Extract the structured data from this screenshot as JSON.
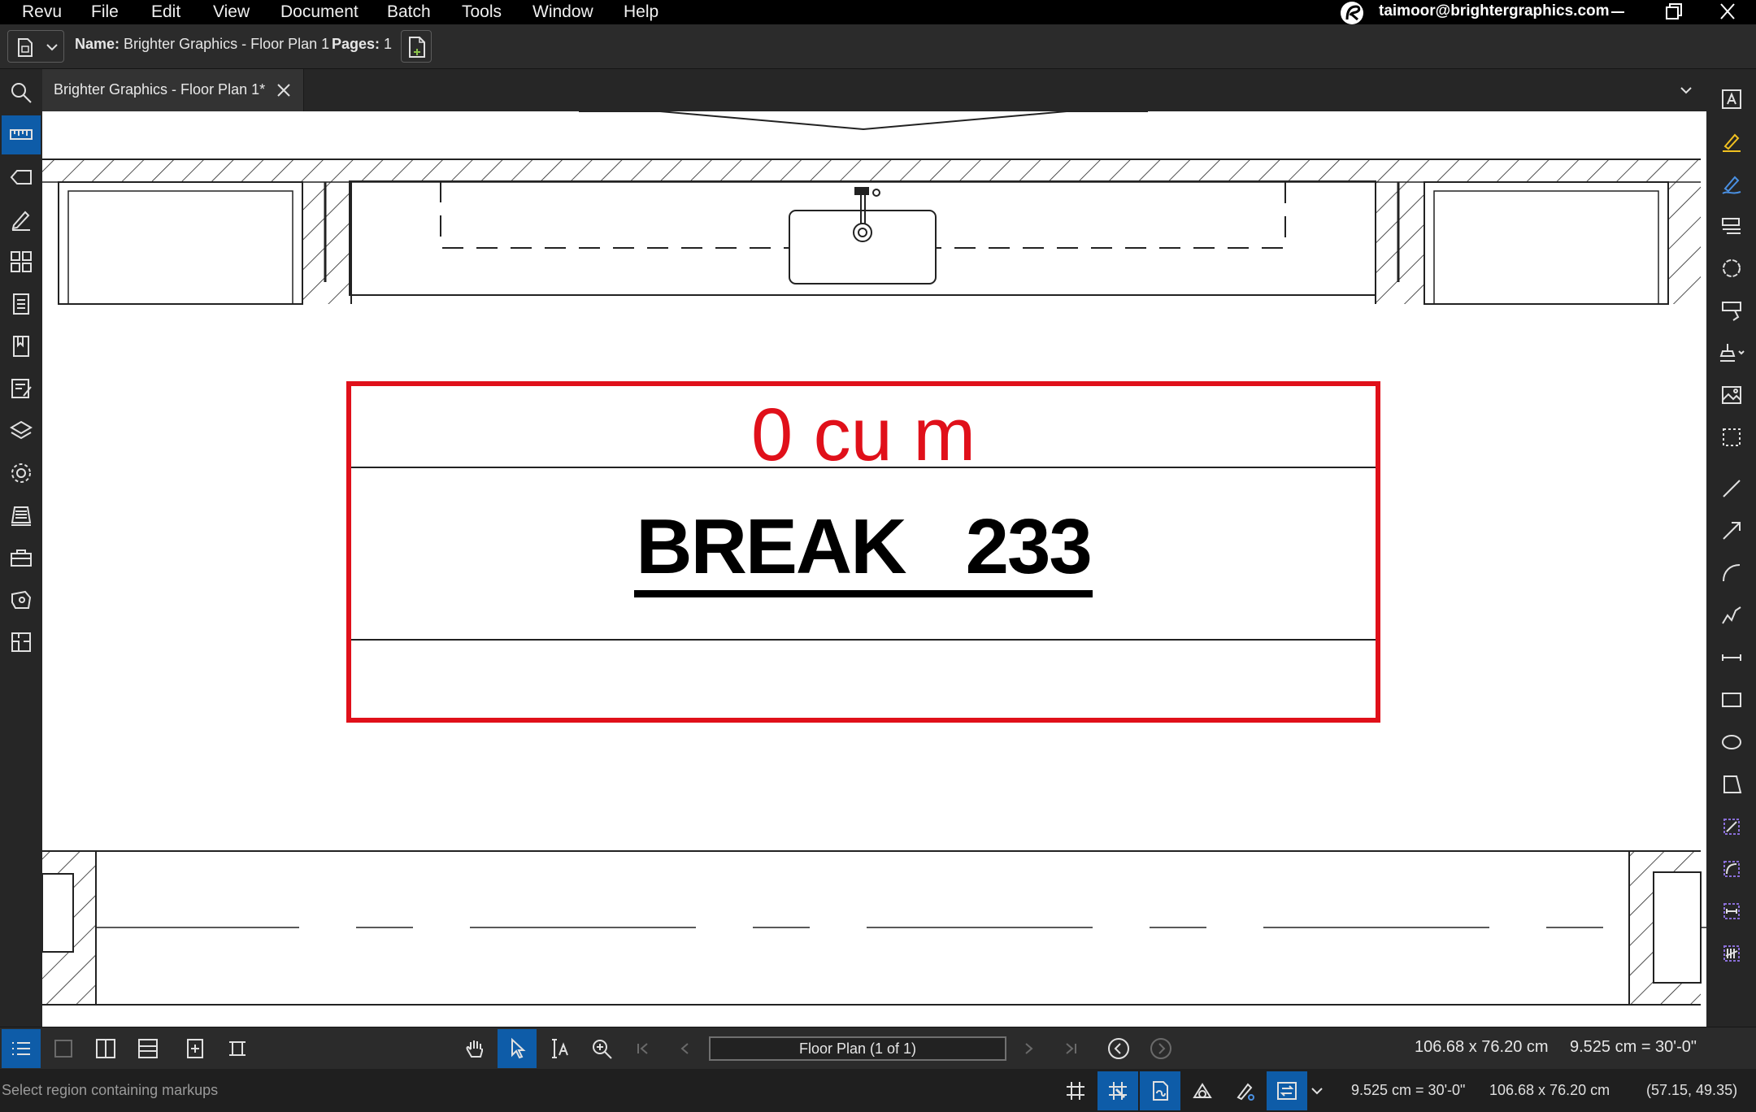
{
  "menu": {
    "items": [
      "Revu",
      "File",
      "Edit",
      "View",
      "Document",
      "Batch",
      "Tools",
      "Window",
      "Help"
    ],
    "account_email": "taimoor@brightergraphics.com"
  },
  "docbar": {
    "name_label": "Name:",
    "name_value": "Brighter Graphics - Floor Plan 1",
    "pages_label": "Pages:",
    "pages_value": "1"
  },
  "tab": {
    "title": "Brighter Graphics - Floor Plan 1*"
  },
  "left_panel_icons": [
    "search-icon",
    "measure-icon",
    "tag-icon",
    "markup-pen-icon",
    "thumbnails-icon",
    "markups-list-icon",
    "bookmarks-icon",
    "forms-icon",
    "layers-icon",
    "settings-icon",
    "signatures-icon",
    "toolbox-icon",
    "spaces-icon",
    "sets-icon"
  ],
  "right_tool_icons": [
    "text-box-icon",
    "highlighter-icon",
    "pen-icon",
    "typewriter-icon",
    "cloud-icon",
    "callout-icon",
    "stamp-icon",
    "image-icon",
    "crop-icon",
    "line-icon",
    "arrow-icon",
    "arc-icon",
    "polyline-icon",
    "dimension-icon",
    "rectangle-icon",
    "ellipse-icon",
    "polygon-icon",
    "perimeter-icon",
    "area-icon",
    "length-icon",
    "count-icon"
  ],
  "canvas": {
    "volume_label": "0 cu m",
    "room_name": "BREAK   233"
  },
  "bottombar": {
    "page_navigator": "Floor Plan (1 of 1)",
    "page_size": "106.68 x 76.20 cm",
    "scale": "9.525 cm = 30'-0\""
  },
  "statusbar": {
    "message": "Select region containing markups",
    "scale": "9.525 cm = 30'-0\"",
    "page_size": "106.68 x 76.20 cm",
    "cursor": "(57.15, 49.35)"
  },
  "colors": {
    "accent": "#0e5ca8",
    "markup_red": "#e0101a"
  }
}
